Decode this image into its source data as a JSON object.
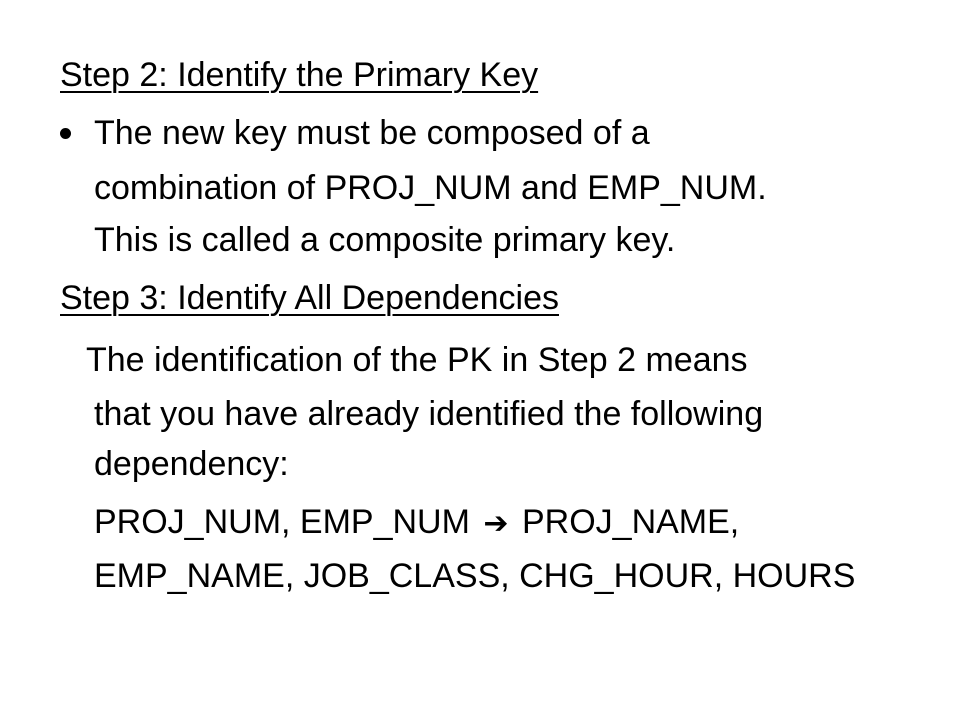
{
  "slide": {
    "step2_heading": "Step 2: Identify the Primary Key",
    "bullet_lines": [
      "The new key must be composed of a",
      "combination of PROJ_NUM and EMP_NUM.",
      "This is called a composite primary key."
    ],
    "step3_heading": "Step 3: Identify All Dependencies",
    "para_lines": [
      "The identification of the PK in Step 2 means",
      "that you have already identified the following",
      "dependency:"
    ],
    "dependency": {
      "lhs": "PROJ_NUM, EMP_NUM",
      "arrow": "➔",
      "rhs_line1": "PROJ_NAME,",
      "line2": "EMP_NAME, JOB_CLASS, CHG_HOUR, HOURS"
    }
  }
}
